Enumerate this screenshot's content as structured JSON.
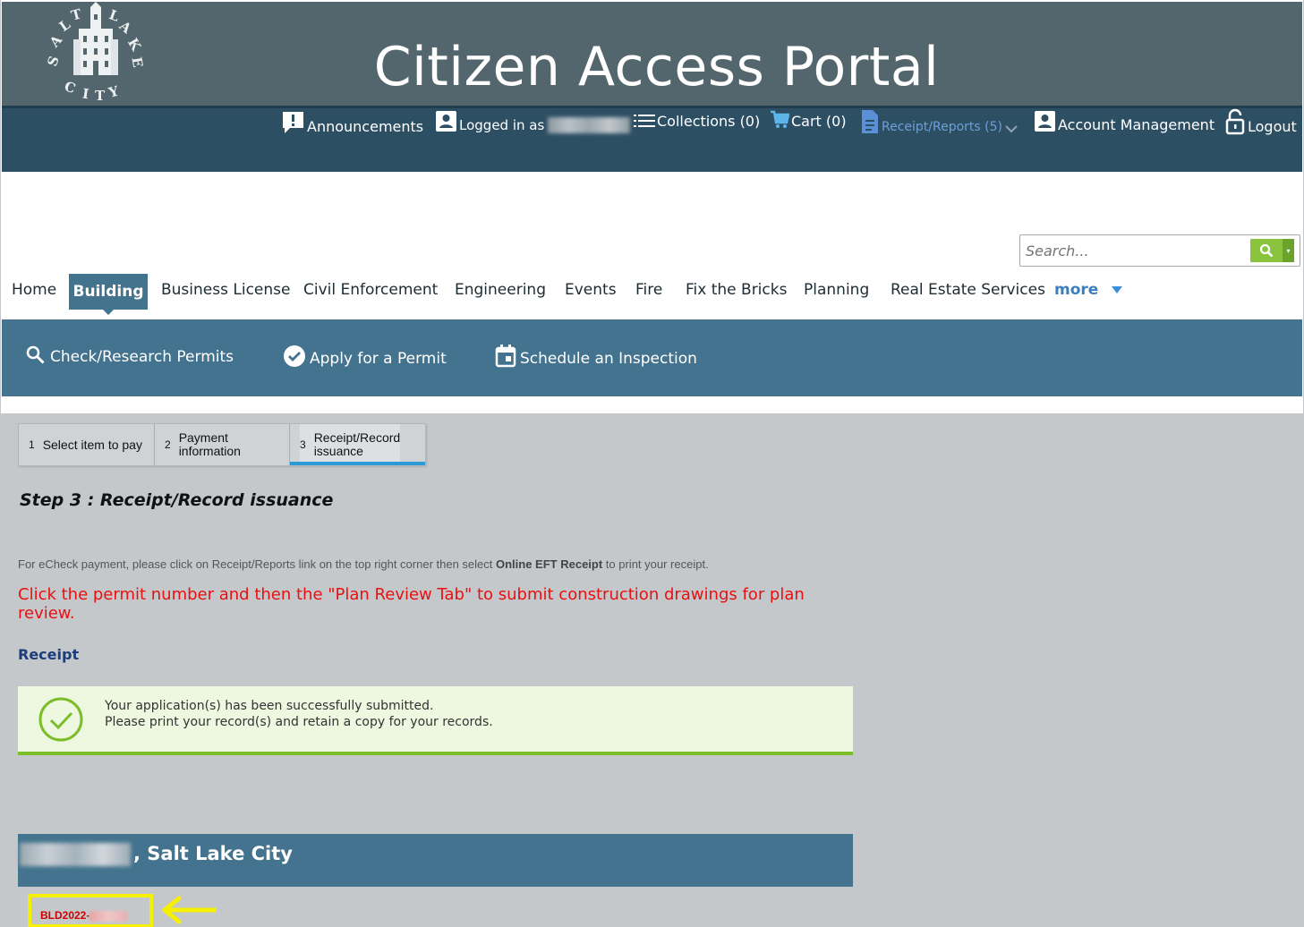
{
  "header": {
    "title": "Citizen Access Portal",
    "logo_text": "SALT LAKE CITY"
  },
  "topbar": {
    "announcements": "Announcements",
    "logged_in": "Logged in as",
    "collections": "Collections (0)",
    "cart": "Cart (0)",
    "receipts": "Receipt/Reports (5)",
    "account": "Account Management",
    "logout": "Logout"
  },
  "search": {
    "placeholder": "Search..."
  },
  "nav": {
    "home": "Home",
    "building": "Building",
    "business_license": "Business License",
    "civil_enforcement": "Civil Enforcement",
    "engineering": "Engineering",
    "events": "Events",
    "fire": "Fire",
    "fix_the_bricks": "Fix the Bricks",
    "planning": "Planning",
    "real_estate": "Real Estate Services",
    "more": "more"
  },
  "subnav": {
    "check": "Check/Research Permits",
    "apply": "Apply for a Permit",
    "schedule": "Schedule an Inspection"
  },
  "steps": {
    "s1_num": "1",
    "s1_label": "Select item to pay",
    "s2_num": "2",
    "s2_label_1": "Payment",
    "s2_label_2": "information",
    "s3_num": "3",
    "s3_label_1": "Receipt/Record",
    "s3_label_2": "issuance"
  },
  "content": {
    "step_title": "Step 3 : Receipt/Record issuance",
    "echeck_pre": "For eCheck payment, please click on Receipt/Reports link on the top right corner then select ",
    "echeck_bold": "Online EFT Receipt",
    "echeck_post": " to print your receipt.",
    "red_note": "Click the permit number and then the \"Plan Review Tab\" to submit construction drawings for plan review.",
    "receipt_heading": "Receipt",
    "success_line1": "Your application(s) has been successfully submitted.",
    "success_line2": "Please print your record(s) and retain a copy for your records.",
    "record_location": ", Salt Lake City",
    "permit_prefix": "BLD2022-"
  },
  "colors": {
    "header_bg": "#54666d",
    "topbar_bg": "#2d4f63",
    "nav_active": "#44738e",
    "success_border": "#7cbd2a",
    "alert_red": "#e81010",
    "highlight_yellow": "#f5f000"
  }
}
